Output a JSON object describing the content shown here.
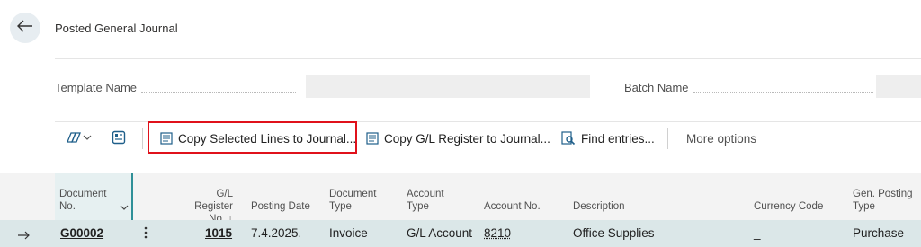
{
  "header": {
    "title": "Posted General Journal"
  },
  "fields": {
    "template_name_label": "Template Name",
    "batch_name_label": "Batch Name"
  },
  "actions": {
    "copy_selected": "Copy Selected Lines to Journal...",
    "copy_gl_register": "Copy G/L Register to Journal...",
    "find_entries": "Find entries...",
    "more_options": "More options"
  },
  "grid": {
    "columns": {
      "document_no_1": "Document",
      "document_no_2": "No.",
      "gl_register_1": "G/L Register",
      "gl_register_2": "No. ↓",
      "posting_date": "Posting Date",
      "document_type_1": "Document",
      "document_type_2": "Type",
      "account_type_1": "Account",
      "account_type_2": "Type",
      "account_no": "Account No.",
      "description": "Description",
      "currency_code": "Currency Code",
      "gen_posting_1": "Gen. Posting",
      "gen_posting_2": "Type"
    },
    "rows": [
      {
        "document_no": "G00002",
        "gl_register_no": "1015",
        "posting_date": "7.4.2025.",
        "document_type": "Invoice",
        "account_type": "G/L Account",
        "account_no": "8210",
        "description": "Office Supplies",
        "currency_code": "_",
        "gen_posting_type": "Purchase"
      }
    ]
  },
  "colors": {
    "accent": "#2f8f97",
    "highlight_border": "#e0111b",
    "selected_row": "#dbe7e8"
  }
}
